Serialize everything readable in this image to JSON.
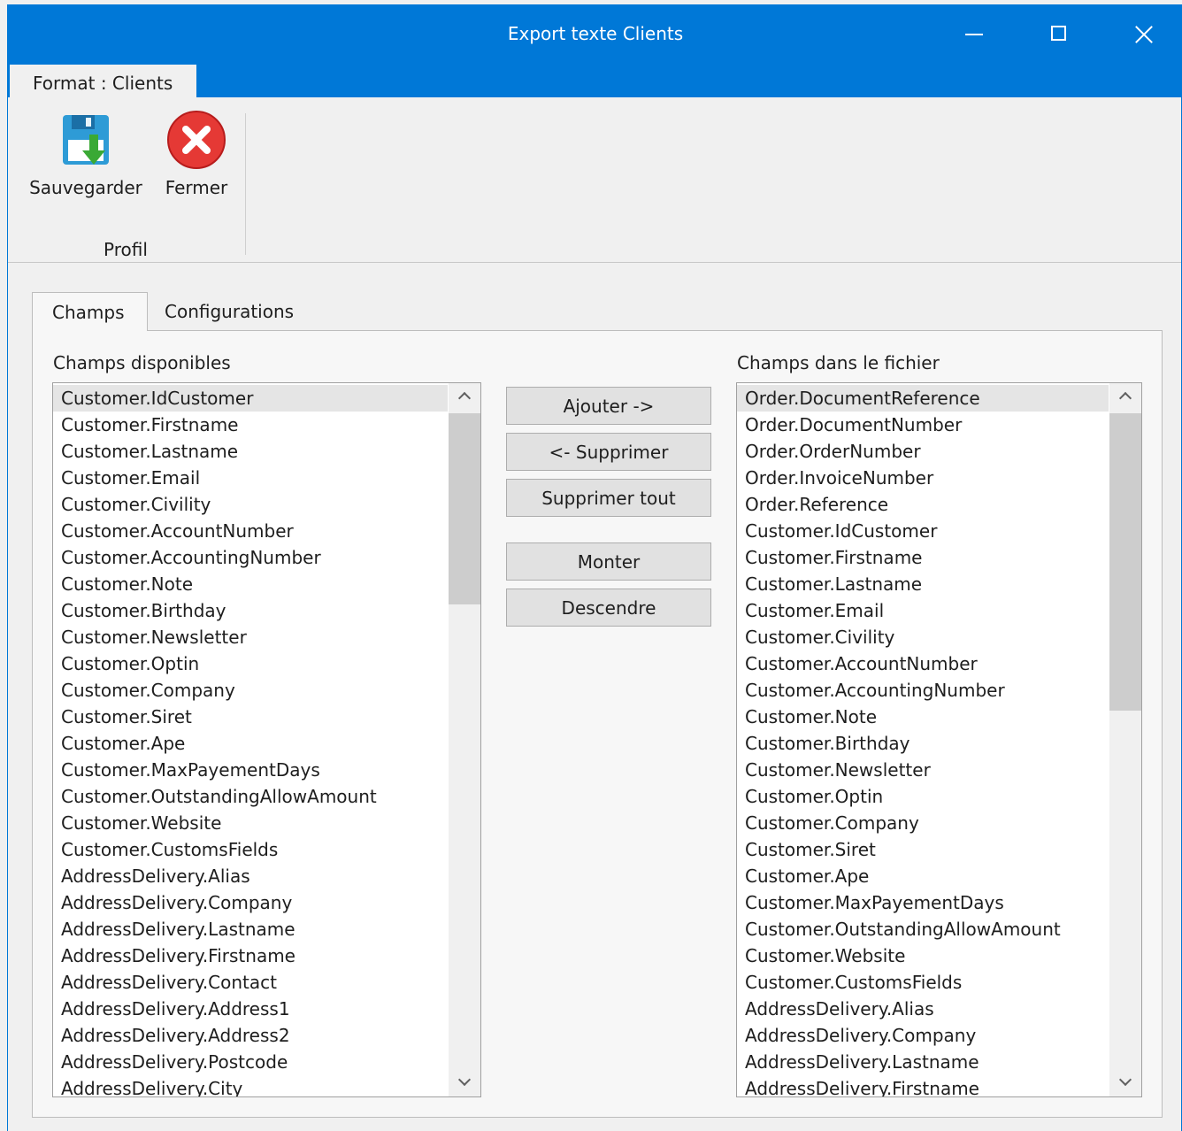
{
  "window": {
    "title": "Export texte Clients",
    "controls": [
      "minimize-icon",
      "maximize-icon",
      "close-icon"
    ]
  },
  "ribbon": {
    "tab_label": "Format : Clients",
    "save_label": "Sauvegarder",
    "close_label": "Fermer",
    "group_label": "Profil"
  },
  "tabs": {
    "fields": "Champs",
    "configurations": "Configurations"
  },
  "available": {
    "label": "Champs disponibles",
    "items": [
      "Customer.IdCustomer",
      "Customer.Firstname",
      "Customer.Lastname",
      "Customer.Email",
      "Customer.Civility",
      "Customer.AccountNumber",
      "Customer.AccountingNumber",
      "Customer.Note",
      "Customer.Birthday",
      "Customer.Newsletter",
      "Customer.Optin",
      "Customer.Company",
      "Customer.Siret",
      "Customer.Ape",
      "Customer.MaxPayementDays",
      "Customer.OutstandingAllowAmount",
      "Customer.Website",
      "Customer.CustomsFields",
      "AddressDelivery.Alias",
      "AddressDelivery.Company",
      "AddressDelivery.Lastname",
      "AddressDelivery.Firstname",
      "AddressDelivery.Contact",
      "AddressDelivery.Address1",
      "AddressDelivery.Address2",
      "AddressDelivery.Postcode",
      "AddressDelivery.City"
    ]
  },
  "in_file": {
    "label": "Champs dans le fichier",
    "items": [
      "Order.DocumentReference",
      "Order.DocumentNumber",
      "Order.OrderNumber",
      "Order.InvoiceNumber",
      "Order.Reference",
      "Customer.IdCustomer",
      "Customer.Firstname",
      "Customer.Lastname",
      "Customer.Email",
      "Customer.Civility",
      "Customer.AccountNumber",
      "Customer.AccountingNumber",
      "Customer.Note",
      "Customer.Birthday",
      "Customer.Newsletter",
      "Customer.Optin",
      "Customer.Company",
      "Customer.Siret",
      "Customer.Ape",
      "Customer.MaxPayementDays",
      "Customer.OutstandingAllowAmount",
      "Customer.Website",
      "Customer.CustomsFields",
      "AddressDelivery.Alias",
      "AddressDelivery.Company",
      "AddressDelivery.Lastname",
      "AddressDelivery.Firstname"
    ]
  },
  "buttons": {
    "add": "Ajouter ->",
    "remove": "<- Supprimer",
    "remove_all": "Supprimer tout",
    "up": "Monter",
    "down": "Descendre"
  },
  "colors": {
    "title_bar": "#0078d7",
    "save_icon_body": "#2e9bd6",
    "save_arrow": "#3aa935",
    "close_icon": "#e53935"
  }
}
